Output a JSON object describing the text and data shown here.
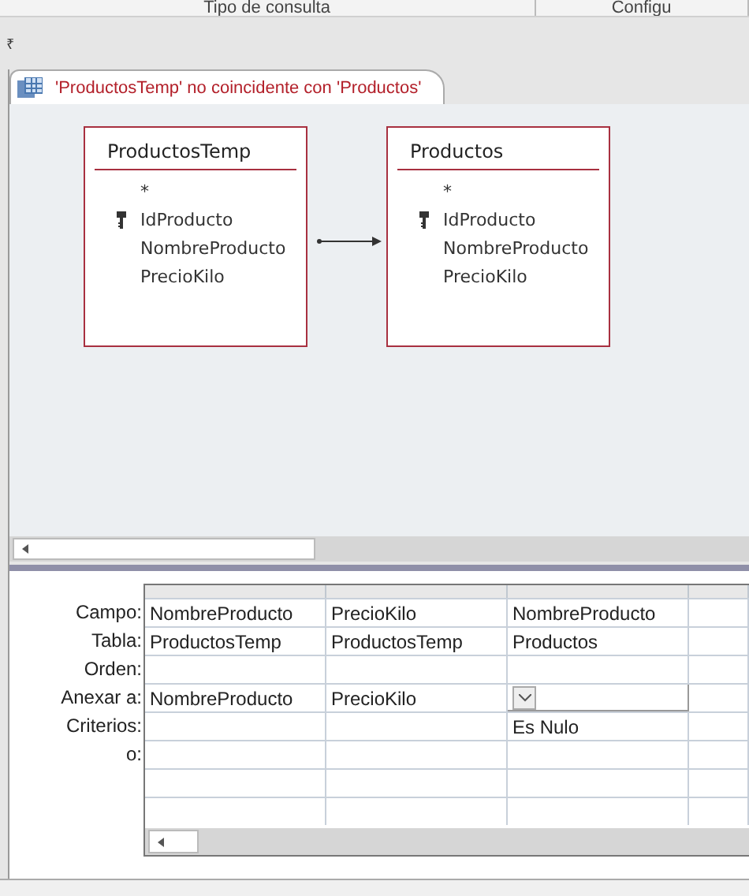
{
  "ribbon_groups": [
    "Tipo de consulta",
    "Configu"
  ],
  "quick_access": {
    "glyph": "₹"
  },
  "tab": {
    "title": "'ProductosTemp' no coincidente con 'Productos'",
    "selected": true
  },
  "tables": [
    {
      "name": "ProductosTemp",
      "fields": [
        {
          "name": "*",
          "primary_key": false
        },
        {
          "name": "IdProducto",
          "primary_key": true
        },
        {
          "name": "NombreProducto",
          "primary_key": false
        },
        {
          "name": "PrecioKilo",
          "primary_key": false
        }
      ]
    },
    {
      "name": "Productos",
      "fields": [
        {
          "name": "*",
          "primary_key": false
        },
        {
          "name": "IdProducto",
          "primary_key": true
        },
        {
          "name": "NombreProducto",
          "primary_key": false
        },
        {
          "name": "PrecioKilo",
          "primary_key": false
        }
      ]
    }
  ],
  "grid": {
    "rows": [
      {
        "label": "Campo:",
        "cells": [
          {
            "text": "NombreProducto",
            "dropdown": false
          },
          {
            "text": "PrecioKilo",
            "dropdown": false
          },
          {
            "text": "NombreProducto",
            "dropdown": false
          },
          {
            "dropdown": false
          }
        ]
      },
      {
        "label": "Tabla:",
        "cells": [
          {
            "text": "ProductosTemp",
            "dropdown": false
          },
          {
            "text": "ProductosTemp",
            "dropdown": false
          },
          {
            "text": "Productos",
            "dropdown": false
          },
          {
            "dropdown": false
          }
        ]
      },
      {
        "label": "Orden:",
        "cells": [
          {
            "dropdown": false
          },
          {
            "dropdown": false
          },
          {
            "dropdown": false
          },
          {
            "dropdown": false
          }
        ]
      },
      {
        "label": "Anexar a:",
        "cells": [
          {
            "text": "NombreProducto",
            "dropdown": false
          },
          {
            "text": "PrecioKilo",
            "dropdown": false
          },
          {
            "dropdown": true
          },
          {
            "dropdown": false
          }
        ]
      },
      {
        "label": "Criterios:",
        "cells": [
          {
            "dropdown": false
          },
          {
            "dropdown": false
          },
          {
            "text": "Es Nulo",
            "dropdown": false
          },
          {
            "dropdown": false
          }
        ]
      },
      {
        "label": "o:",
        "cells": [
          {
            "dropdown": false
          },
          {
            "dropdown": false
          },
          {
            "dropdown": false
          },
          {
            "dropdown": false
          }
        ]
      }
    ]
  }
}
